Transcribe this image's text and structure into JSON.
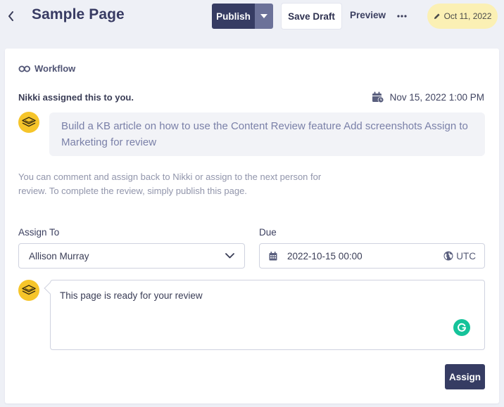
{
  "header": {
    "title": "Sample Page",
    "publish_label": "Publish",
    "save_draft_label": "Save Draft",
    "preview_label": "Preview",
    "date_badge": "Oct 11, 2022"
  },
  "workflow": {
    "heading": "Workflow",
    "assigned_text": "Nikki assigned this to you.",
    "assigned_date": "Nov 15, 2022 1:00 PM",
    "task_message": "Build a KB article on how to use the Content Review feature Add screenshots Assign to Marketing for review",
    "help_text": "You can comment and assign back to Nikki or assign to the next person for review. To complete the review, simply publish this page.",
    "assign_to_label": "Assign To",
    "assign_to_value": "Allison Murray",
    "due_label": "Due",
    "due_value": "2022-10-15 00:00",
    "timezone": "UTC",
    "comment_value": "This page is ready for your review",
    "assign_button": "Assign"
  },
  "colors": {
    "primary": "#363c63",
    "badge_bg": "#fbf0b4",
    "avatar_bg": "#f6c52a",
    "grammarly": "#15c39a",
    "page_bg": "#eef0f6"
  },
  "icons": {
    "back": "chevron-left-icon",
    "publish_menu": "caret-down-icon",
    "more": "more-horizontal-icon",
    "badge": "pencil-icon",
    "workflow": "workflow-loop-icon",
    "assigned_date": "calendar-clock-icon",
    "avatar": "layers-avatar-icon",
    "select": "chevron-down-icon",
    "due": "calendar-icon",
    "timezone": "globe-icon",
    "grammarly": "grammarly-icon"
  }
}
